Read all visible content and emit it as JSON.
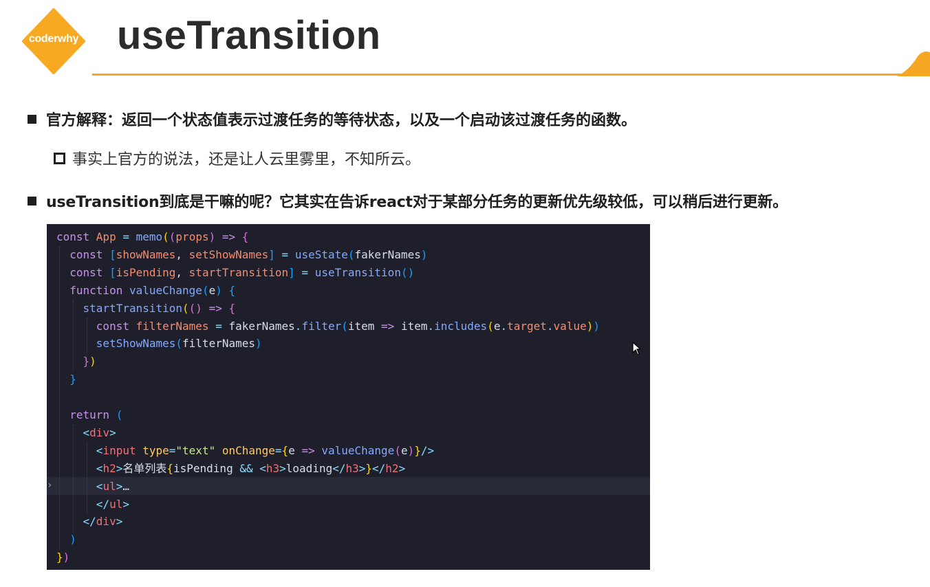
{
  "header": {
    "logo_text": "coderwhy",
    "title": "useTransition",
    "accent_color": "#f5a623"
  },
  "bullets": [
    "官方解释：返回一个状态值表示过渡任务的等待状态，以及一个启动该过渡任务的函数。",
    "事实上官方的说法，还是让人云里雾里，不知所云。",
    "useTransition到底是干嘛的呢？它其实在告诉react对于某部分任务的更新优先级较低，可以稍后进行更新。"
  ],
  "code": {
    "background": "#1e1f2a",
    "lines": [
      [
        [
          "const ",
          "kw"
        ],
        [
          "App",
          "var"
        ],
        [
          " = ",
          "op"
        ],
        [
          "memo",
          "fn"
        ],
        [
          "(",
          "p1"
        ],
        [
          "(",
          "p2"
        ],
        [
          "props",
          "var"
        ],
        [
          ")",
          "p2"
        ],
        [
          " => ",
          "kw"
        ],
        [
          "{",
          "p2"
        ]
      ],
      [
        [
          "  const ",
          "kw"
        ],
        [
          "[",
          "p3"
        ],
        [
          "showNames",
          "var"
        ],
        [
          ", ",
          "plain"
        ],
        [
          "setShowNames",
          "var"
        ],
        [
          "]",
          "p3"
        ],
        [
          " = ",
          "op"
        ],
        [
          "useState",
          "fn"
        ],
        [
          "(",
          "p3"
        ],
        [
          "fakerNames",
          "plain"
        ],
        [
          ")",
          "p3"
        ]
      ],
      [
        [
          "  const ",
          "kw"
        ],
        [
          "[",
          "p3"
        ],
        [
          "isPending",
          "var"
        ],
        [
          ", ",
          "plain"
        ],
        [
          "startTransition",
          "var"
        ],
        [
          "]",
          "p3"
        ],
        [
          " = ",
          "op"
        ],
        [
          "useTransition",
          "fn"
        ],
        [
          "()",
          "p3"
        ]
      ],
      [
        [
          "  function ",
          "kw"
        ],
        [
          "valueChange",
          "fn"
        ],
        [
          "(",
          "p3"
        ],
        [
          "e",
          "plain"
        ],
        [
          ")",
          "p3"
        ],
        [
          " ",
          "plain"
        ],
        [
          "{",
          "p3"
        ]
      ],
      [
        [
          "    startTransition",
          "fn"
        ],
        [
          "(",
          "p1"
        ],
        [
          "()",
          "p2"
        ],
        [
          " => ",
          "kw"
        ],
        [
          "{",
          "p2"
        ]
      ],
      [
        [
          "      const ",
          "kw"
        ],
        [
          "filterNames",
          "var"
        ],
        [
          " = ",
          "op"
        ],
        [
          "fakerNames",
          "plain"
        ],
        [
          ".",
          "op"
        ],
        [
          "filter",
          "fn"
        ],
        [
          "(",
          "p3"
        ],
        [
          "item",
          "plain"
        ],
        [
          " => ",
          "kw"
        ],
        [
          "item",
          "plain"
        ],
        [
          ".",
          "op"
        ],
        [
          "includes",
          "fn"
        ],
        [
          "(",
          "p1"
        ],
        [
          "e",
          "plain"
        ],
        [
          ".",
          "op"
        ],
        [
          "target",
          "var"
        ],
        [
          ".",
          "op"
        ],
        [
          "value",
          "var"
        ],
        [
          ")",
          "p1"
        ],
        [
          ")",
          "p3"
        ]
      ],
      [
        [
          "      setShowNames",
          "fn"
        ],
        [
          "(",
          "p3"
        ],
        [
          "filterNames",
          "plain"
        ],
        [
          ")",
          "p3"
        ]
      ],
      [
        [
          "    }",
          "p2"
        ],
        [
          ")",
          "p1"
        ]
      ],
      [
        [
          "  }",
          "p3"
        ]
      ],
      [
        [
          "",
          "plain"
        ]
      ],
      [
        [
          "  return ",
          "kw"
        ],
        [
          "(",
          "p3"
        ]
      ],
      [
        [
          "    <",
          "op"
        ],
        [
          "div",
          "tag"
        ],
        [
          ">",
          "op"
        ]
      ],
      [
        [
          "      <",
          "op"
        ],
        [
          "input ",
          "tag"
        ],
        [
          "type",
          "attr"
        ],
        [
          "=",
          "op"
        ],
        [
          "\"text\"",
          "str"
        ],
        [
          " onChange",
          "attr"
        ],
        [
          "=",
          "op"
        ],
        [
          "{",
          "p1"
        ],
        [
          "e",
          "plain"
        ],
        [
          " => ",
          "kw"
        ],
        [
          "valueChange",
          "fn"
        ],
        [
          "(",
          "p2"
        ],
        [
          "e",
          "plain"
        ],
        [
          ")",
          "p2"
        ],
        [
          "}",
          "p1"
        ],
        [
          "/>",
          "op"
        ]
      ],
      [
        [
          "      <",
          "op"
        ],
        [
          "h2",
          "tag"
        ],
        [
          ">",
          "op"
        ],
        [
          "名单列表",
          "plain"
        ],
        [
          "{",
          "p1"
        ],
        [
          "isPending",
          "plain"
        ],
        [
          " && ",
          "op"
        ],
        [
          "<",
          "op"
        ],
        [
          "h3",
          "tag"
        ],
        [
          ">",
          "op"
        ],
        [
          "loading",
          "plain"
        ],
        [
          "</",
          "op"
        ],
        [
          "h3",
          "tag"
        ],
        [
          ">",
          "op"
        ],
        [
          "}",
          "p1"
        ],
        [
          "</",
          "op"
        ],
        [
          "h2",
          "tag"
        ],
        [
          ">",
          "op"
        ]
      ],
      [
        [
          "      <",
          "op"
        ],
        [
          "ul",
          "tag"
        ],
        [
          ">",
          "op"
        ],
        [
          "…",
          "plain"
        ]
      ],
      [
        [
          "      </",
          "op"
        ],
        [
          "ul",
          "tag"
        ],
        [
          ">",
          "op"
        ]
      ],
      [
        [
          "    </",
          "op"
        ],
        [
          "div",
          "tag"
        ],
        [
          ">",
          "op"
        ]
      ],
      [
        [
          "  )",
          "p3"
        ]
      ],
      [
        [
          "}",
          "p1"
        ],
        [
          ")",
          "p2"
        ]
      ]
    ]
  }
}
